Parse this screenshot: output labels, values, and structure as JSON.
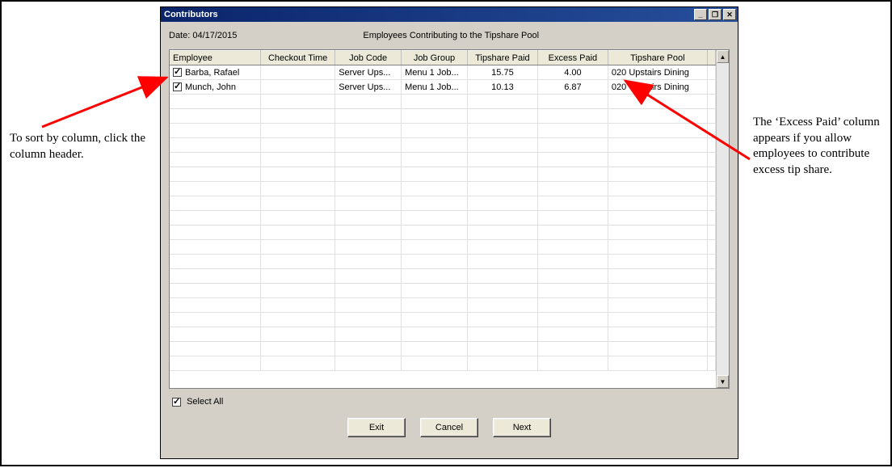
{
  "window": {
    "title": "Contributors",
    "min_label": "_",
    "restore_label": "❐",
    "close_label": "✕"
  },
  "header": {
    "date_label": "Date: 04/17/2015",
    "title": "Employees Contributing to the Tipshare Pool"
  },
  "columns": {
    "employee": "Employee",
    "checkout_time": "Checkout Time",
    "job_code": "Job Code",
    "job_group": "Job Group",
    "tipshare_paid": "Tipshare Paid",
    "excess_paid": "Excess Paid",
    "tipshare_pool": "Tipshare Pool"
  },
  "rows": [
    {
      "checked": true,
      "employee": "Barba, Rafael",
      "checkout_time": "",
      "job_code": "Server Ups...",
      "job_group": "Menu 1 Job...",
      "tipshare_paid": "15.75",
      "excess_paid": "4.00",
      "tipshare_pool": "020 Upstairs Dining"
    },
    {
      "checked": true,
      "employee": "Munch, John",
      "checkout_time": "",
      "job_code": "Server Ups...",
      "job_group": "Menu 1 Job...",
      "tipshare_paid": "10.13",
      "excess_paid": "6.87",
      "tipshare_pool": "020 Upstairs Dining"
    }
  ],
  "selectall": {
    "label": "Select All",
    "checked": true
  },
  "buttons": {
    "exit": "Exit",
    "cancel": "Cancel",
    "next": "Next"
  },
  "annotations": {
    "left": "To sort by column, click the column header.",
    "right": "The ‘Excess Paid’ column appears if you allow employees to contribute excess tip share."
  },
  "scroll": {
    "up_glyph": "▲",
    "down_glyph": "▼"
  }
}
